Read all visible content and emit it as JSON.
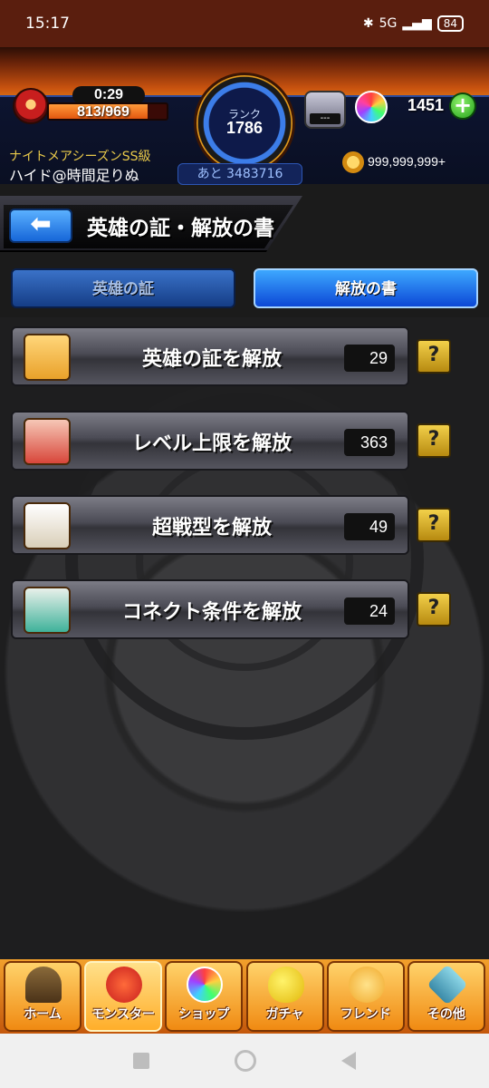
{
  "status_bar": {
    "time": "15:17",
    "network": "5G",
    "battery": "84"
  },
  "header": {
    "timer": "0:29",
    "stamina": "813/969",
    "stamina_fraction": 0.839,
    "rank_label": "ランク",
    "rank": "1786",
    "until_prefix": "あと",
    "until_value": "3483716",
    "gem_box_value": "---",
    "orbs": "1451",
    "plus": "+",
    "season": "ナイトメアシーズンSS級",
    "username": "ハイド@時間足りぬ",
    "coins": "999,999,999+"
  },
  "title": {
    "back_icon": "arrow-left-icon",
    "text": "英雄の証・解放の書"
  },
  "tabs": [
    {
      "label": "英雄の証",
      "active": false
    },
    {
      "label": "解放の書",
      "active": true
    }
  ],
  "rows": [
    {
      "label": "英雄の証を解放",
      "count": "29",
      "scroll_color": "#e9a12a"
    },
    {
      "label": "レベル上限を解放",
      "count": "363",
      "scroll_color": "#d8463a"
    },
    {
      "label": "超戦型を解放",
      "count": "49",
      "scroll_color": "#e6dcc6"
    },
    {
      "label": "コネクト条件を解放",
      "count": "24",
      "scroll_color": "#3fb29a"
    }
  ],
  "help_label": "?",
  "bottom_nav": [
    {
      "label": "ホーム",
      "icon": "home-icon"
    },
    {
      "label": "モンスター",
      "icon": "monster-icon",
      "active": true
    },
    {
      "label": "ショップ",
      "icon": "shop-orb-icon"
    },
    {
      "label": "ガチャ",
      "icon": "gacha-egg-icon"
    },
    {
      "label": "フレンド",
      "icon": "friends-icon"
    },
    {
      "label": "その他",
      "icon": "other-icon"
    }
  ]
}
